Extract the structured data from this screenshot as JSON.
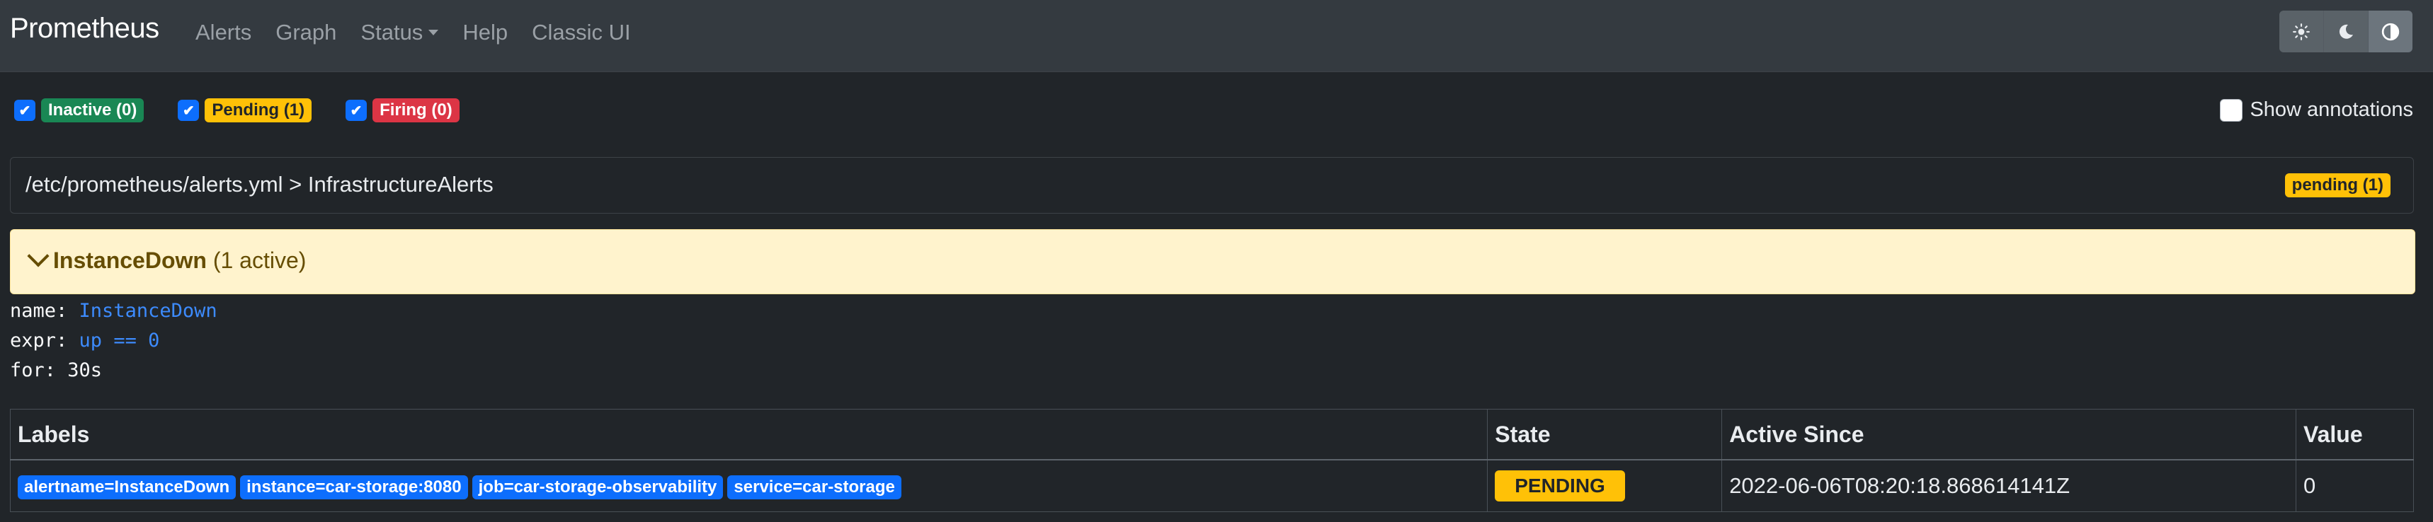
{
  "navbar": {
    "brand": "Prometheus",
    "links": [
      "Alerts",
      "Graph",
      "Status",
      "Help",
      "Classic UI"
    ],
    "theme_buttons": [
      "sun-icon",
      "moon-icon",
      "contrast-icon"
    ]
  },
  "filters": {
    "inactive": "Inactive (0)",
    "pending": "Pending (1)",
    "firing": "Firing (0)"
  },
  "show_annotations": "Show annotations",
  "group": {
    "title": "/etc/prometheus/alerts.yml > InfrastructureAlerts",
    "badge": "pending (1)"
  },
  "alert": {
    "name": "InstanceDown",
    "active": "(1 active)"
  },
  "rule": {
    "name_key": "name: ",
    "name_val": "InstanceDown",
    "expr_key": "expr: ",
    "expr_val": "up == 0",
    "for_line": "for: 30s"
  },
  "table": {
    "headers": [
      "Labels",
      "State",
      "Active Since",
      "Value"
    ],
    "labels": [
      "alertname=InstanceDown",
      "instance=car-storage:8080",
      "job=car-storage-observability",
      "service=car-storage"
    ],
    "state": "PENDING",
    "active_since": "2022-06-06T08:20:18.868614141Z",
    "value": "0"
  },
  "colors": {
    "navbar": "#343a40",
    "background": "#212529",
    "pending": "#ffc107",
    "inactive": "#198754",
    "firing": "#dc3545",
    "label": "#0d6efd"
  }
}
